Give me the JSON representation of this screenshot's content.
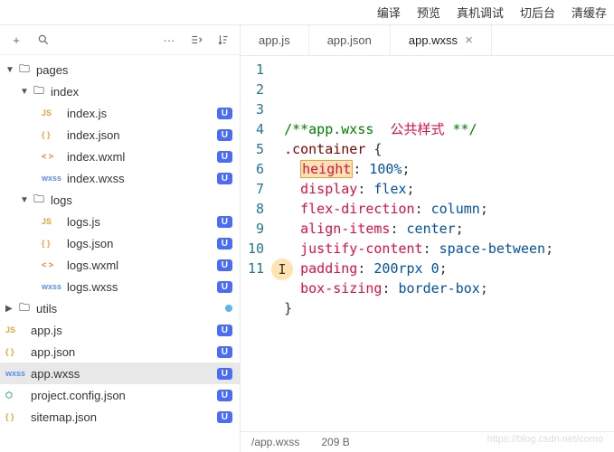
{
  "topMenu": [
    "编译",
    "预览",
    "真机调试",
    "切后台",
    "清缓存"
  ],
  "toolbar": {
    "add": "+",
    "search": "Q",
    "more": "···"
  },
  "tree": [
    {
      "type": "folder",
      "label": "pages",
      "indent": 0,
      "open": true
    },
    {
      "type": "folder",
      "label": "index",
      "indent": 1,
      "open": true
    },
    {
      "type": "file",
      "label": "index.js",
      "icon": "JS",
      "iconClass": "js",
      "indent": 2,
      "badge": "U"
    },
    {
      "type": "file",
      "label": "index.json",
      "icon": "{ }",
      "iconClass": "json",
      "indent": 2,
      "badge": "U"
    },
    {
      "type": "file",
      "label": "index.wxml",
      "icon": "< >",
      "iconClass": "wxml",
      "indent": 2,
      "badge": "U"
    },
    {
      "type": "file",
      "label": "index.wxss",
      "icon": "wxss",
      "iconClass": "wxss",
      "indent": 2,
      "badge": "U"
    },
    {
      "type": "folder",
      "label": "logs",
      "indent": 1,
      "open": true
    },
    {
      "type": "file",
      "label": "logs.js",
      "icon": "JS",
      "iconClass": "js",
      "indent": 2,
      "badge": "U"
    },
    {
      "type": "file",
      "label": "logs.json",
      "icon": "{ }",
      "iconClass": "json",
      "indent": 2,
      "badge": "U"
    },
    {
      "type": "file",
      "label": "logs.wxml",
      "icon": "< >",
      "iconClass": "wxml",
      "indent": 2,
      "badge": "U"
    },
    {
      "type": "file",
      "label": "logs.wxss",
      "icon": "wxss",
      "iconClass": "wxss",
      "indent": 2,
      "badge": "U"
    },
    {
      "type": "folder",
      "label": "utils",
      "indent": 0,
      "open": false,
      "dot": true
    },
    {
      "type": "file",
      "label": "app.js",
      "icon": "JS",
      "iconClass": "js",
      "indent": 0,
      "badge": "U"
    },
    {
      "type": "file",
      "label": "app.json",
      "icon": "{ }",
      "iconClass": "json",
      "indent": 0,
      "badge": "U"
    },
    {
      "type": "file",
      "label": "app.wxss",
      "icon": "wxss",
      "iconClass": "wxss",
      "indent": 0,
      "badge": "U",
      "selected": true
    },
    {
      "type": "file",
      "label": "project.config.json",
      "icon": "⬡",
      "iconClass": "config",
      "indent": 0,
      "badge": "U"
    },
    {
      "type": "file",
      "label": "sitemap.json",
      "icon": "{ }",
      "iconClass": "json",
      "indent": 0,
      "badge": "U"
    }
  ],
  "tabs": [
    {
      "label": "app.js",
      "active": false
    },
    {
      "label": "app.json",
      "active": false
    },
    {
      "label": "app.wxss",
      "active": true
    }
  ],
  "code": {
    "lines": [
      [
        {
          "t": "/**app.wxss",
          "c": "c-comment"
        },
        {
          "t": "  公共样式 ",
          "c": "c-comment-cn"
        },
        {
          "t": "**/",
          "c": "c-comment"
        }
      ],
      [
        {
          "t": ".container",
          "c": "c-selector"
        },
        {
          "t": " {",
          "c": "c-punct"
        }
      ],
      [
        {
          "t": "  ",
          "c": ""
        },
        {
          "t": "height",
          "c": "c-prop",
          "hl": true
        },
        {
          "t": ": ",
          "c": "c-punct"
        },
        {
          "t": "100%",
          "c": "c-val"
        },
        {
          "t": ";",
          "c": "c-punct"
        }
      ],
      [
        {
          "t": "  ",
          "c": ""
        },
        {
          "t": "display",
          "c": "c-prop"
        },
        {
          "t": ": ",
          "c": "c-punct"
        },
        {
          "t": "flex",
          "c": "c-val"
        },
        {
          "t": ";",
          "c": "c-punct"
        }
      ],
      [
        {
          "t": "  ",
          "c": ""
        },
        {
          "t": "flex-direction",
          "c": "c-prop"
        },
        {
          "t": ": ",
          "c": "c-punct"
        },
        {
          "t": "column",
          "c": "c-val"
        },
        {
          "t": ";",
          "c": "c-punct"
        }
      ],
      [
        {
          "t": "  ",
          "c": ""
        },
        {
          "t": "align-items",
          "c": "c-prop"
        },
        {
          "t": ": ",
          "c": "c-punct"
        },
        {
          "t": "center",
          "c": "c-val"
        },
        {
          "t": ";",
          "c": "c-punct"
        }
      ],
      [
        {
          "t": "  ",
          "c": ""
        },
        {
          "t": "justify-content",
          "c": "c-prop"
        },
        {
          "t": ": ",
          "c": "c-punct"
        },
        {
          "t": "space-between",
          "c": "c-val"
        },
        {
          "t": ";",
          "c": "c-punct"
        }
      ],
      [
        {
          "t": "  ",
          "c": ""
        },
        {
          "t": "padding",
          "c": "c-prop"
        },
        {
          "t": ": ",
          "c": "c-punct"
        },
        {
          "t": "200rpx 0",
          "c": "c-val"
        },
        {
          "t": ";",
          "c": "c-punct"
        }
      ],
      [
        {
          "t": "  ",
          "c": ""
        },
        {
          "t": "box-sizing",
          "c": "c-prop"
        },
        {
          "t": ": ",
          "c": "c-punct"
        },
        {
          "t": "border-box",
          "c": "c-val"
        },
        {
          "t": ";",
          "c": "c-punct"
        }
      ],
      [
        {
          "t": "}",
          "c": "c-punct"
        }
      ],
      [
        {
          "t": "",
          "c": ""
        }
      ]
    ]
  },
  "status": {
    "path": "/app.wxss",
    "size": "209 B"
  },
  "watermark": "https://blog.csdn.net/como"
}
